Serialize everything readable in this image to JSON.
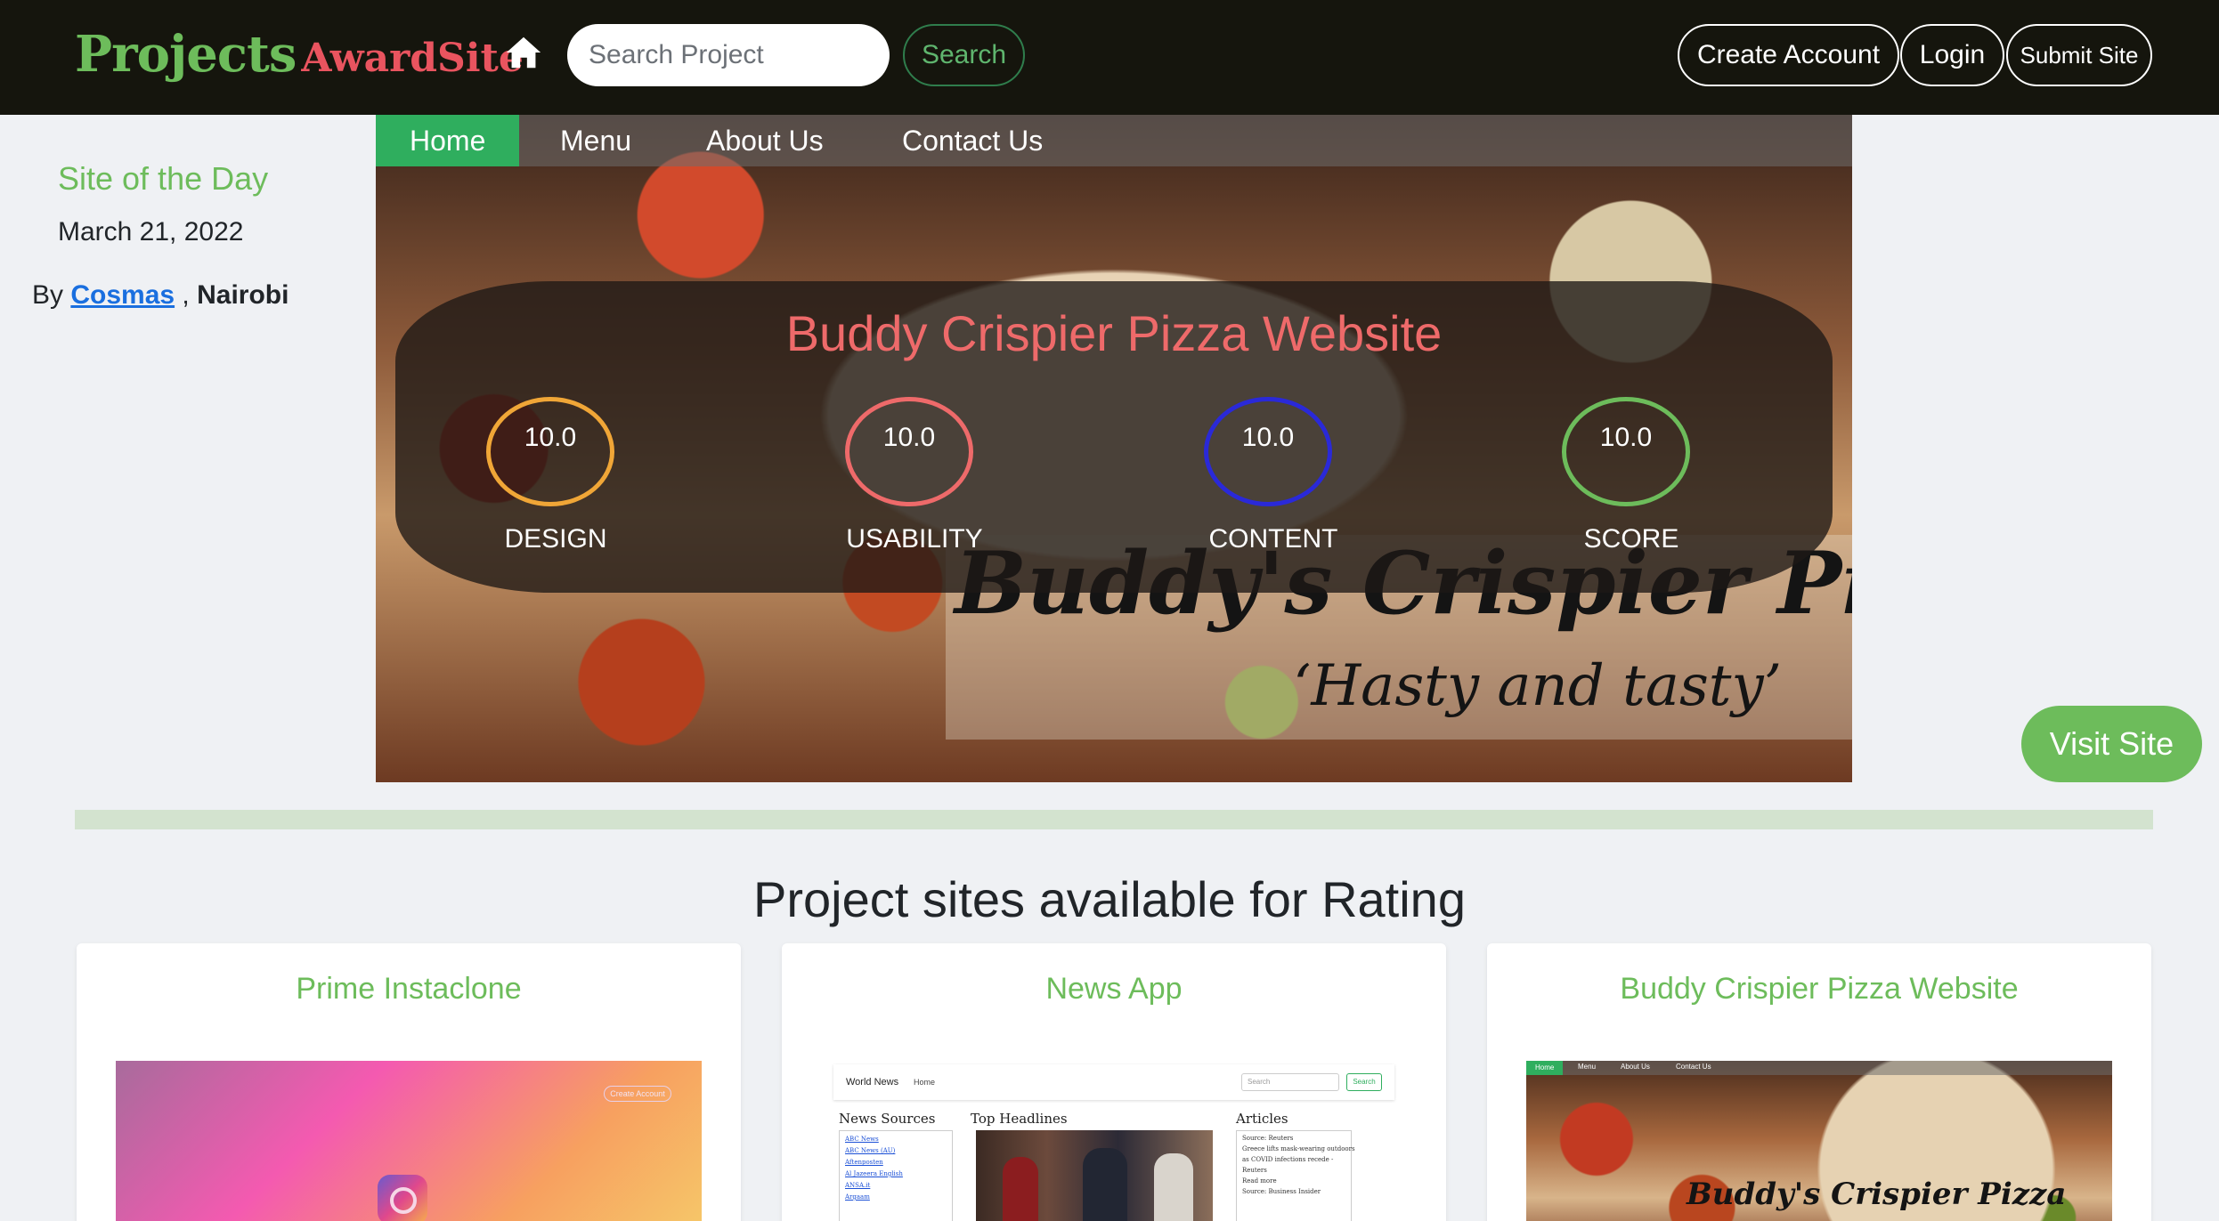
{
  "nav": {
    "brand_primary": "Projects",
    "brand_secondary": "AwardSite",
    "home_icon": "home-icon",
    "search_placeholder": "Search Project",
    "search_label": "Search",
    "create_account_label": "Create Account",
    "login_label": "Login",
    "submit_site_label": "Submit Site"
  },
  "site_of_day": {
    "heading": "Site of the Day",
    "date": "March 21, 2022",
    "by_prefix": "By",
    "author": "Cosmas",
    "separator": ",",
    "location": "Nairobi"
  },
  "hero": {
    "menu": [
      "Home",
      "Menu",
      "About Us",
      "Contact Us"
    ],
    "logo_text": "Buddy's Crispier Pizza",
    "logo_tagline": "‘Hasty and tasty’",
    "title": "Buddy Crispier Pizza Website",
    "ratings": [
      {
        "label": "DESIGN",
        "value": "10.0",
        "color": "#f0a637"
      },
      {
        "label": "USABILITY",
        "value": "10.0",
        "color": "#ee6a6a"
      },
      {
        "label": "CONTENT",
        "value": "10.0",
        "color": "#2a29d8"
      },
      {
        "label": "SCORE",
        "value": "10.0",
        "color": "#6dbc5b"
      }
    ],
    "visit_label": "Visit Site"
  },
  "section": {
    "title": "Project sites available for Rating"
  },
  "cards": [
    {
      "title": "Prime Instaclone",
      "preview": {
        "button": "Create Account"
      }
    },
    {
      "title": "News App",
      "preview": {
        "brand": "World News",
        "home": "Home",
        "search_placeholder": "Search",
        "search_button": "Search",
        "col_sources": "News Sources",
        "col_headlines": "Top Headlines",
        "col_articles": "Articles",
        "sources": [
          "ABC News",
          "ABC News (AU)",
          "Aftenposten",
          "Al Jazeera English",
          "ANSA.it",
          "Argaam"
        ],
        "articles": [
          "Source: Reuters",
          "Greece lifts mask-wearing outdoors",
          "as COVID infections recede -",
          "Reuters",
          "Read more",
          "Source: Business Insider"
        ]
      }
    },
    {
      "title": "Buddy Crispier Pizza Website",
      "preview": {
        "menu": [
          "Home",
          "Menu",
          "About Us",
          "Contact Us"
        ],
        "logo": "Buddy's Crispier Pizza"
      }
    }
  ],
  "colors": {
    "accent_green": "#6dbc5b",
    "brand_red": "#e9545f",
    "nav_bg": "#15150d",
    "page_bg": "#eff1f4"
  }
}
